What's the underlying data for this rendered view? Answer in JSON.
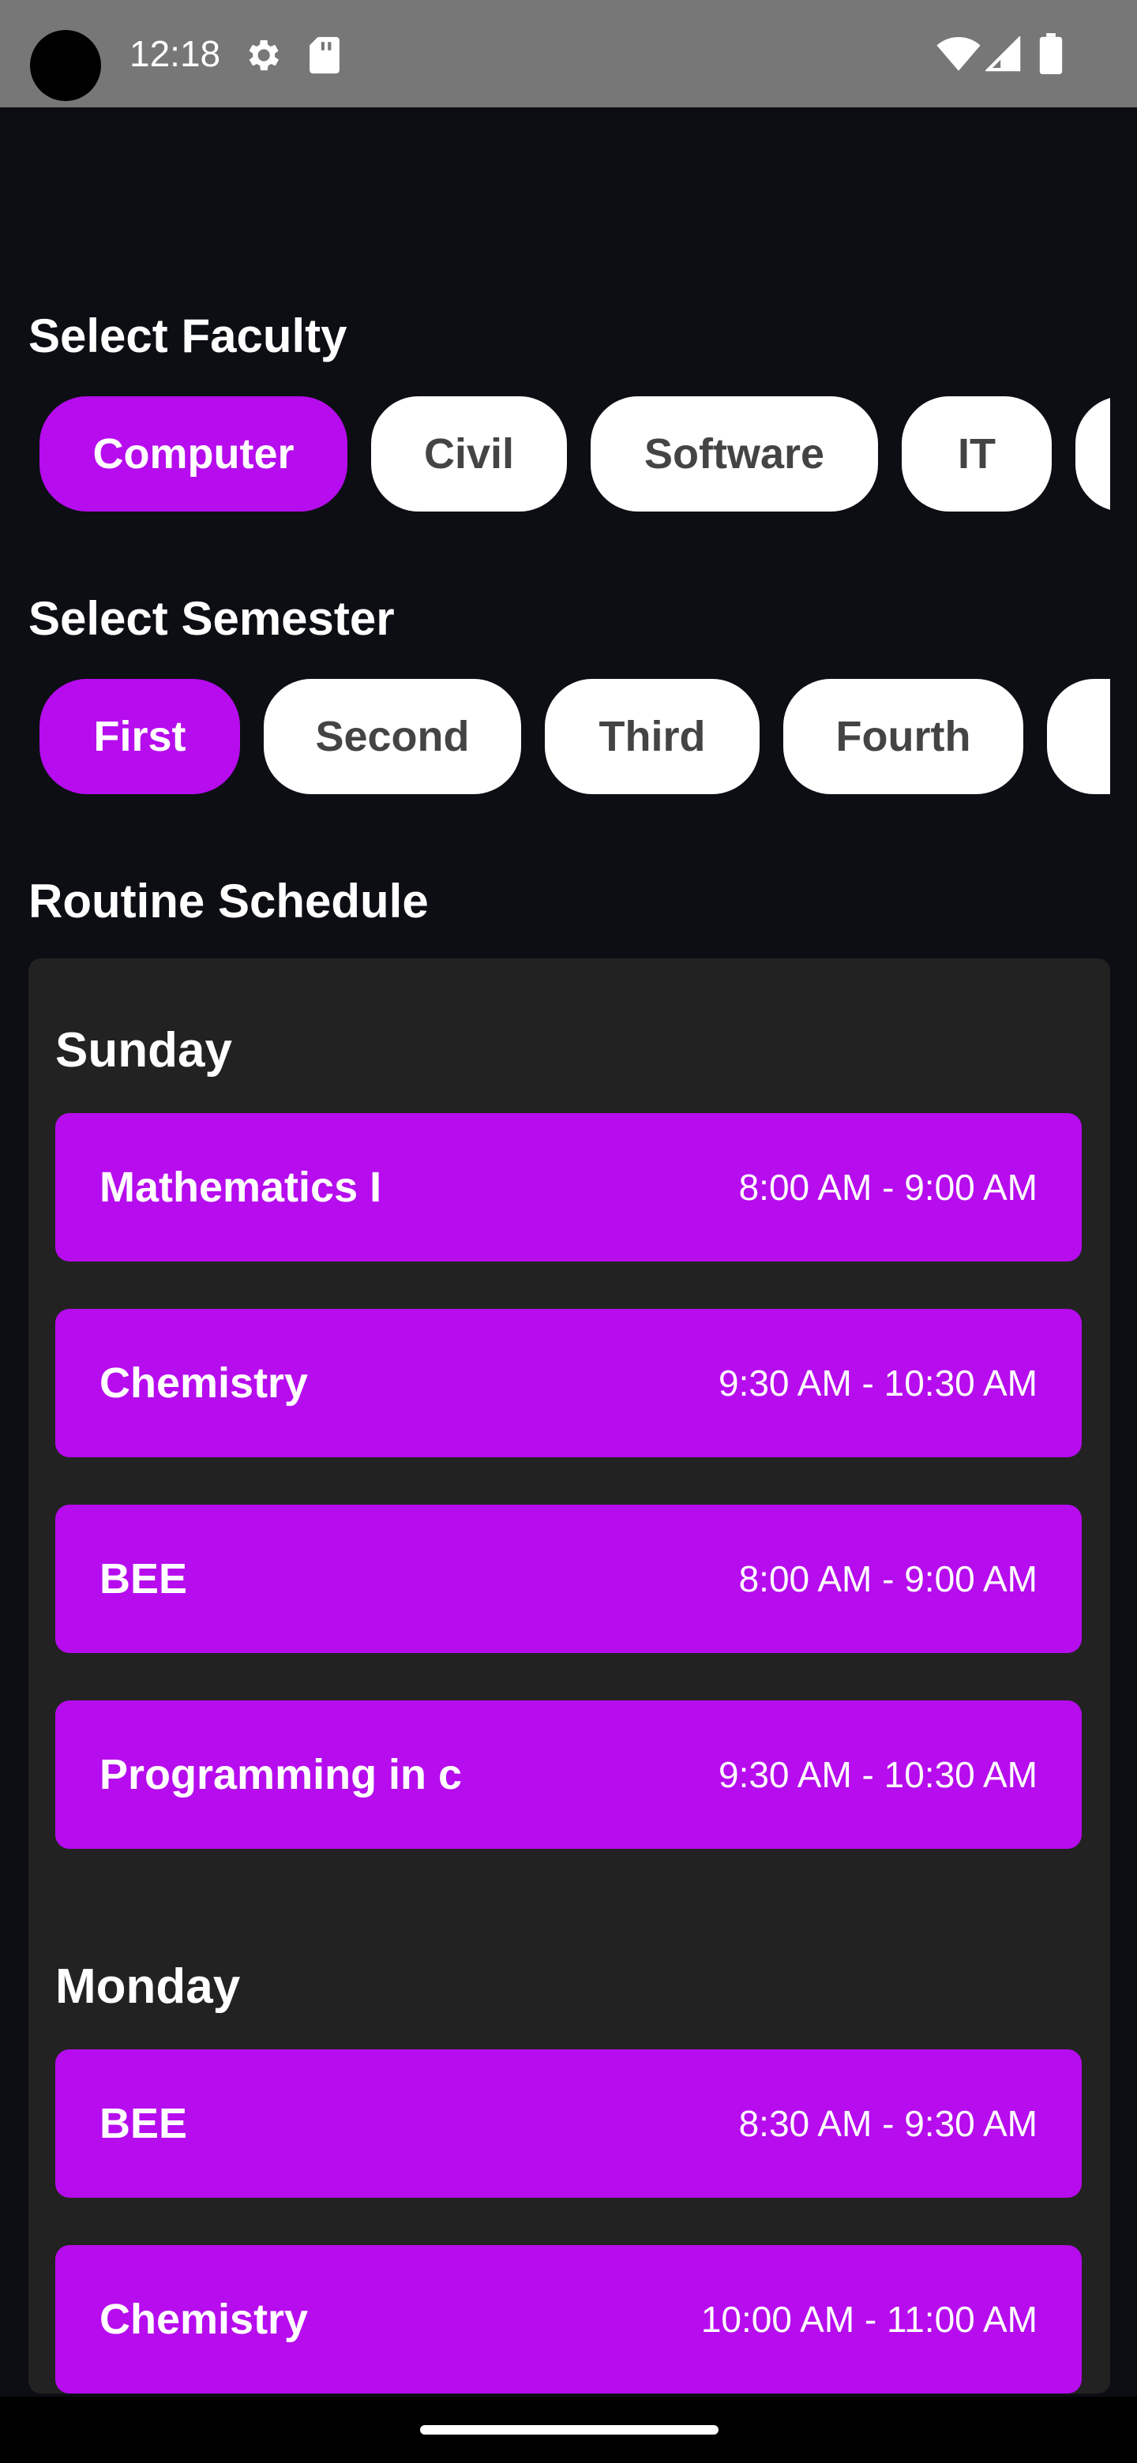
{
  "status_bar": {
    "time": "12:18",
    "icons": [
      "settings-gear-icon",
      "sd-card-icon",
      "wifi-icon",
      "cell-signal-icon",
      "battery-icon"
    ]
  },
  "faculty": {
    "title": "Select Faculty",
    "chips": [
      {
        "label": "Computer",
        "selected": true
      },
      {
        "label": "Civil",
        "selected": false
      },
      {
        "label": "Software",
        "selected": false
      },
      {
        "label": "IT",
        "selected": false
      },
      {
        "label": "",
        "selected": false
      }
    ]
  },
  "semester": {
    "title": "Select Semester",
    "chips": [
      {
        "label": "First",
        "selected": true
      },
      {
        "label": "Second",
        "selected": false
      },
      {
        "label": "Third",
        "selected": false
      },
      {
        "label": "Fourth",
        "selected": false
      },
      {
        "label": "",
        "selected": false
      }
    ]
  },
  "schedule": {
    "title": "Routine Schedule",
    "days": [
      {
        "name": "Sunday",
        "classes": [
          {
            "subject": "Mathematics I",
            "time": "8:00 AM - 9:00 AM"
          },
          {
            "subject": "Chemistry",
            "time": "9:30 AM - 10:30 AM"
          },
          {
            "subject": "BEE",
            "time": "8:00 AM - 9:00 AM"
          },
          {
            "subject": "Programming in c",
            "time": "9:30 AM - 10:30 AM"
          }
        ]
      },
      {
        "name": "Monday",
        "classes": [
          {
            "subject": "BEE",
            "time": "8:30 AM - 9:30 AM"
          },
          {
            "subject": "Chemistry",
            "time": "10:00 AM - 11:00 AM"
          }
        ]
      }
    ]
  },
  "colors": {
    "accent": "#b60cee",
    "background": "#0c0e14",
    "card": "#222222",
    "chip": "#ffffff",
    "chip_text": "#444444"
  }
}
